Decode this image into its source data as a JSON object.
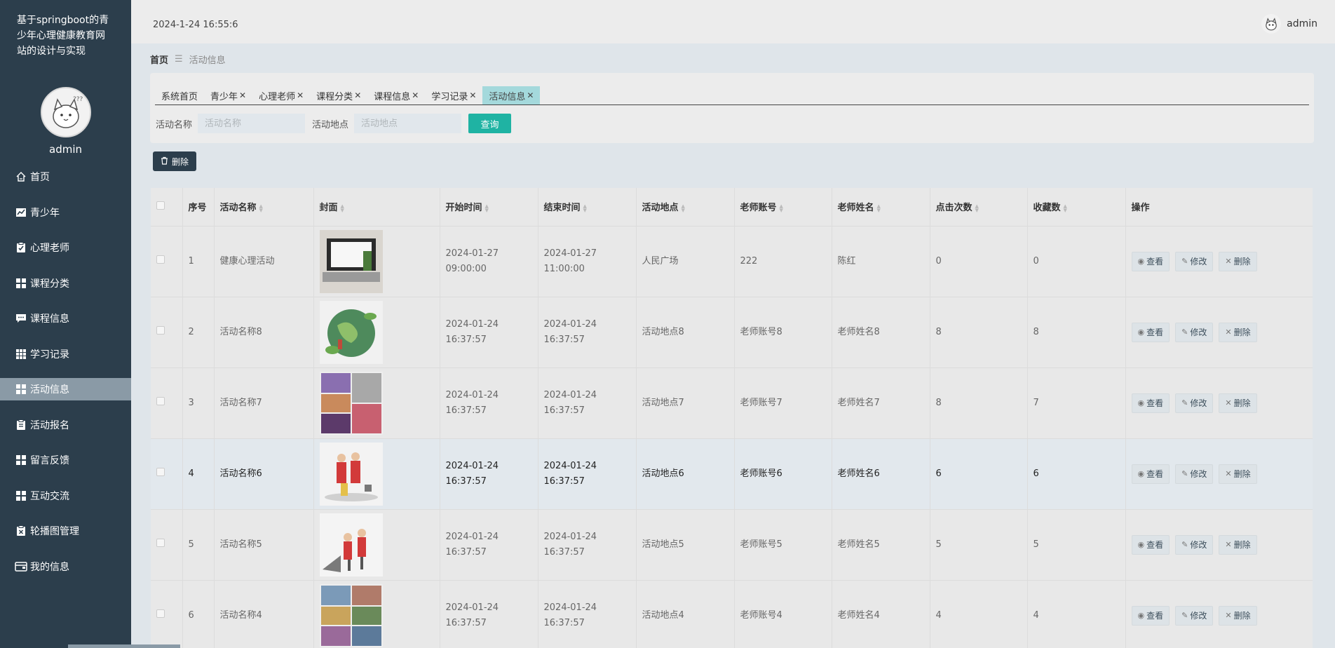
{
  "app": {
    "title": "基于springboot的青少年心理健康教育网站的设计与实现",
    "username": "admin",
    "datetime": "2024-1-24 16:55:6"
  },
  "sidebar": {
    "items": [
      {
        "label": "首页",
        "icon": "home-icon"
      },
      {
        "label": "青少年",
        "icon": "chart-line-icon"
      },
      {
        "label": "心理老师",
        "icon": "clipboard-check-icon"
      },
      {
        "label": "课程分类",
        "icon": "grid-icon"
      },
      {
        "label": "课程信息",
        "icon": "chat-icon"
      },
      {
        "label": "学习记录",
        "icon": "grid-nine-icon"
      },
      {
        "label": "活动信息",
        "icon": "grid-icon",
        "active": true
      },
      {
        "label": "活动报名",
        "icon": "clipboard-icon"
      },
      {
        "label": "留言反馈",
        "icon": "grid-icon"
      },
      {
        "label": "互动交流",
        "icon": "grid-icon"
      },
      {
        "label": "轮播图管理",
        "icon": "clipboard-x-icon"
      },
      {
        "label": "我的信息",
        "icon": "wallet-icon"
      }
    ]
  },
  "breadcrumb": {
    "home": "首页",
    "sep": "☰",
    "current": "活动信息"
  },
  "tabs": [
    {
      "label": "系统首页",
      "closable": false
    },
    {
      "label": "青少年",
      "closable": true
    },
    {
      "label": "心理老师",
      "closable": true
    },
    {
      "label": "课程分类",
      "closable": true
    },
    {
      "label": "课程信息",
      "closable": true
    },
    {
      "label": "学习记录",
      "closable": true
    },
    {
      "label": "活动信息",
      "closable": true,
      "active": true
    }
  ],
  "search": {
    "name_label": "活动名称",
    "name_placeholder": "活动名称",
    "place_label": "活动地点",
    "place_placeholder": "活动地点",
    "query_label": "查询"
  },
  "batch_delete_label": "删除",
  "table": {
    "headers": [
      "序号",
      "活动名称",
      "封面",
      "开始时间",
      "结束时间",
      "活动地点",
      "老师账号",
      "老师姓名",
      "点击次数",
      "收藏数",
      "操作"
    ],
    "sortable": [
      false,
      true,
      true,
      true,
      true,
      true,
      true,
      true,
      true,
      true,
      false
    ],
    "actions": {
      "view": "查看",
      "edit": "修改",
      "delete": "删除"
    },
    "rows": [
      {
        "no": "1",
        "name": "健康心理活动",
        "cover": "laptop-desk",
        "start": "2024-01-27 09:00:00",
        "end": "2024-01-27 11:00:00",
        "place": "人民广场",
        "account": "222",
        "teacher": "陈红",
        "clicks": "0",
        "favs": "0"
      },
      {
        "no": "2",
        "name": "活动名称8",
        "cover": "earth-plants",
        "start": "2024-01-24 16:37:57",
        "end": "2024-01-24 16:37:57",
        "place": "活动地点8",
        "account": "老师账号8",
        "teacher": "老师姓名8",
        "clicks": "8",
        "favs": "8"
      },
      {
        "no": "3",
        "name": "活动名称7",
        "cover": "photo-collage",
        "start": "2024-01-24 16:37:57",
        "end": "2024-01-24 16:37:57",
        "place": "活动地点7",
        "account": "老师账号7",
        "teacher": "老师姓名7",
        "clicks": "8",
        "favs": "7"
      },
      {
        "no": "4",
        "name": "活动名称6",
        "cover": "volunteers-cleaning",
        "start": "2024-01-24 16:37:57",
        "end": "2024-01-24 16:37:57",
        "place": "活动地点6",
        "account": "老师账号6",
        "teacher": "老师姓名6",
        "clicks": "6",
        "favs": "6",
        "highlight": true
      },
      {
        "no": "5",
        "name": "活动名称5",
        "cover": "volunteers-stairs",
        "start": "2024-01-24 16:37:57",
        "end": "2024-01-24 16:37:57",
        "place": "活动地点5",
        "account": "老师账号5",
        "teacher": "老师姓名5",
        "clicks": "5",
        "favs": "5"
      },
      {
        "no": "6",
        "name": "活动名称4",
        "cover": "photo-grid",
        "start": "2024-01-24 16:37:57",
        "end": "2024-01-24 16:37:57",
        "place": "活动地点4",
        "account": "老师账号4",
        "teacher": "老师姓名4",
        "clicks": "4",
        "favs": "4"
      }
    ]
  },
  "colors": {
    "sidebar_bg": "#2c3e4c",
    "active_menu": "#8a9aa6",
    "accent": "#1fb3a3",
    "active_tab": "#a4d9dc"
  }
}
